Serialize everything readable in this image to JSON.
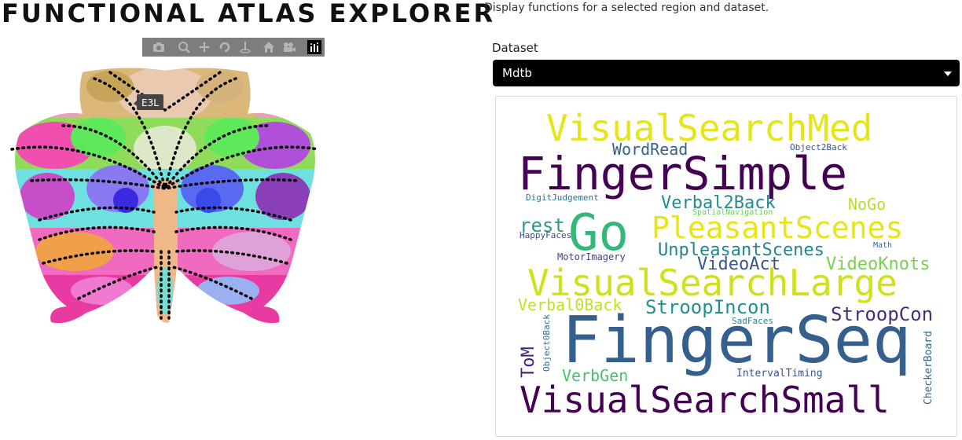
{
  "app": {
    "title": "FUNCTIONAL ATLAS EXPLORER",
    "subtitle": "Display functions for a selected region and dataset."
  },
  "dataset": {
    "label": "Dataset",
    "selected": "Mdtb"
  },
  "toolbar": {
    "buttons": [
      "camera-icon",
      "zoom-icon",
      "pan-icon",
      "lasso-icon",
      "reset-axes-icon",
      "home-icon",
      "video-icon",
      "plotly-logo-icon"
    ]
  },
  "map": {
    "hover_label": "E3L"
  },
  "wordcloud": {
    "words": [
      {
        "text": "VisualSearchMed",
        "color": "#e6e51a"
      },
      {
        "text": "WordRead",
        "color": "#33638d"
      },
      {
        "text": "Object2Back",
        "color": "#3b528b"
      },
      {
        "text": "FingerSimple",
        "color": "#440154"
      },
      {
        "text": "DigitJudgement",
        "color": "#2c728e"
      },
      {
        "text": "Verbal2Back",
        "color": "#238a8d"
      },
      {
        "text": "NoGo",
        "color": "#b5de2b"
      },
      {
        "text": "SpatialNavigation",
        "color": "#6ccd5a"
      },
      {
        "text": "rest",
        "color": "#2a9b86"
      },
      {
        "text": "Go",
        "color": "#35b779"
      },
      {
        "text": "PleasantScenes",
        "color": "#e7e419"
      },
      {
        "text": "HappyFaces",
        "color": "#3e4989"
      },
      {
        "text": "Math",
        "color": "#2f6c8e"
      },
      {
        "text": "MotorImagery",
        "color": "#414487"
      },
      {
        "text": "UnpleasantScenes",
        "color": "#25858e"
      },
      {
        "text": "VideoAct",
        "color": "#39568c"
      },
      {
        "text": "VideoKnots",
        "color": "#7ad151"
      },
      {
        "text": "VisualSearchLarge",
        "color": "#d0e11c"
      },
      {
        "text": "Verbal0Back",
        "color": "#c2df23"
      },
      {
        "text": "StroopIncon",
        "color": "#21918c"
      },
      {
        "text": "StroopCon",
        "color": "#472d7b"
      },
      {
        "text": "SadFaces",
        "color": "#26828e"
      },
      {
        "text": "Object0Back",
        "color": "#2c728e"
      },
      {
        "text": "FingerSeq",
        "color": "#355f8d"
      },
      {
        "text": "ToM",
        "color": "#482475"
      },
      {
        "text": "CheckerBoard",
        "color": "#31688e"
      },
      {
        "text": "VerbGen",
        "color": "#4ac16d"
      },
      {
        "text": "IntervalTiming",
        "color": "#3b528b"
      },
      {
        "text": "VisualSearchSmall",
        "color": "#440154"
      }
    ]
  }
}
